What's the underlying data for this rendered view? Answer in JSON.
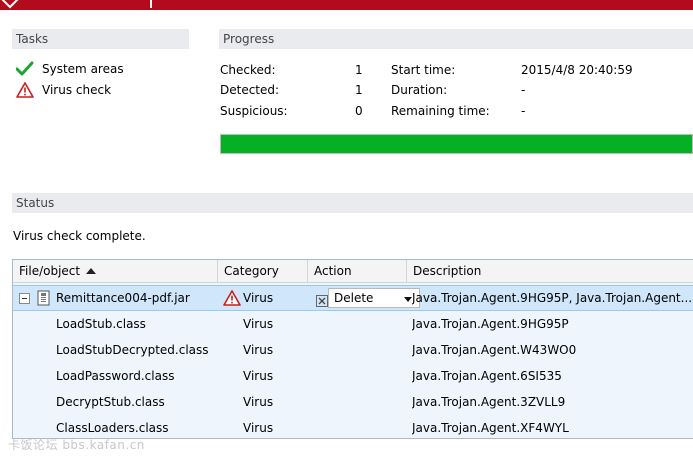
{
  "colors": {
    "title_bar": "#b30b1b",
    "progress_fill": "#06b025",
    "selected_row": "#cfe6fb",
    "grid_bg": "#eef5fc"
  },
  "tasks": {
    "header": "Tasks",
    "items": [
      {
        "label": "System areas",
        "icon": "check-icon"
      },
      {
        "label": "Virus check",
        "icon": "warning-icon"
      }
    ]
  },
  "progress": {
    "header": "Progress",
    "checked_label": "Checked:",
    "checked_value": "1",
    "detected_label": "Detected:",
    "detected_value": "1",
    "suspicious_label": "Suspicious:",
    "suspicious_value": "0",
    "start_label": "Start time:",
    "start_value": "2015/4/8 20:40:59",
    "duration_label": "Duration:",
    "duration_value": "-",
    "remaining_label": "Remaining time:",
    "remaining_value": "-",
    "percent": 100
  },
  "status": {
    "header": "Status",
    "message": "Virus check complete."
  },
  "grid": {
    "columns": [
      "File/object",
      "Category",
      "Action",
      "Description"
    ],
    "parent": {
      "name": "Remittance004-pdf.jar",
      "category": "Virus",
      "action": "Delete",
      "description": "Java.Trojan.Agent.9HG95P, Java.Trojan.Agent...."
    },
    "children": [
      {
        "name": "LoadStub.class",
        "category": "Virus",
        "description": "Java.Trojan.Agent.9HG95P"
      },
      {
        "name": "LoadStubDecrypted.class",
        "category": "Virus",
        "description": "Java.Trojan.Agent.W43WO0"
      },
      {
        "name": "LoadPassword.class",
        "category": "Virus",
        "description": "Java.Trojan.Agent.6SI535"
      },
      {
        "name": "DecryptStub.class",
        "category": "Virus",
        "description": "Java.Trojan.Agent.3ZVLL9"
      },
      {
        "name": "ClassLoaders.class",
        "category": "Virus",
        "description": "Java.Trojan.Agent.XF4WYL"
      }
    ]
  },
  "watermark": "卡饭论坛 bbs.kafan.cn"
}
